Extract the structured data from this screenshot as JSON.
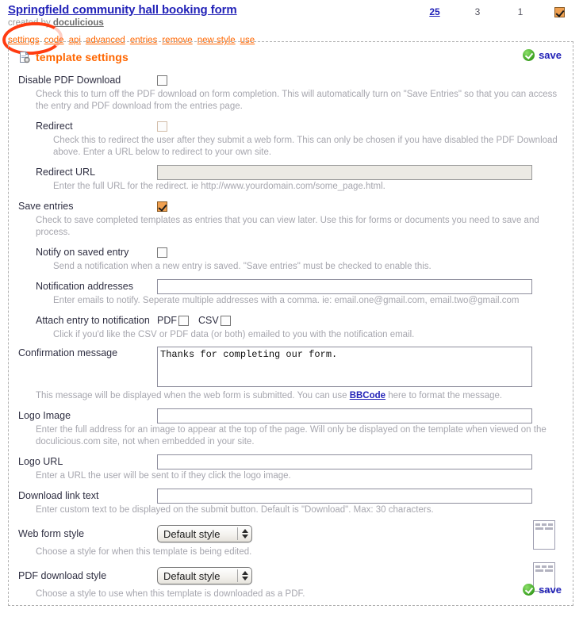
{
  "header": {
    "title": "Springfield community hall booking form",
    "created_prefix": "created by",
    "author": "doculicious",
    "nav": [
      {
        "label": "settings"
      },
      {
        "label": "code"
      },
      {
        "label": "api"
      },
      {
        "label": "advanced"
      },
      {
        "label": "entries"
      },
      {
        "label": "remove"
      },
      {
        "label": "new style"
      },
      {
        "label": "use"
      }
    ],
    "stats": {
      "entries_count": "25",
      "second_count": "3",
      "third_count": "1",
      "active_icon": "checkbox-checked-icon"
    },
    "annotation": "settings-highlight-circle"
  },
  "panel": {
    "icon": "document-gear-icon",
    "title": "template settings",
    "save_top": {
      "label": "save",
      "icon": "green-check-icon"
    },
    "save_bottom": {
      "label": "save",
      "icon": "green-check-icon"
    },
    "fields": {
      "disable_pdf": {
        "label": "Disable PDF Download",
        "checked": false,
        "help": "Check this to turn off the PDF download on form completion. This will automatically turn on \"Save Entries\" so that you can access the entry and PDF download from the entries page."
      },
      "redirect": {
        "label": "Redirect",
        "checked": false,
        "disabled": true,
        "help": "Check this to redirect the user after they submit a web form. This can only be chosen if you have disabled the PDF Download above. Enter a URL below to redirect to your own site."
      },
      "redirect_url": {
        "label": "Redirect URL",
        "value": "",
        "placeholder": "",
        "disabled": true,
        "help": "Enter the full URL for the redirect. ie http://www.yourdomain.com/some_page.html."
      },
      "save_entries": {
        "label": "Save entries",
        "checked": true,
        "help": "Check to save completed templates as entries that you can view later. Use this for forms or documents you need to save and process."
      },
      "notify_on_saved_entry": {
        "label": "Notify on saved entry",
        "checked": false,
        "help": "Send a notification when a new entry is saved. \"Save entries\" must be checked to enable this."
      },
      "notification_addresses": {
        "label": "Notification addresses",
        "value": "",
        "placeholder": "",
        "help": "Enter emails to notify. Seperate multiple addresses with a comma. ie: email.one@gmail.com, email.two@gmail.com"
      },
      "attach_entry": {
        "label": "Attach entry to notification",
        "pdf_label": "PDF",
        "pdf_checked": false,
        "csv_label": "CSV",
        "csv_checked": false,
        "help": "Click if you'd like the CSV or PDF data (or both) emailed to you with the notification email."
      },
      "confirmation_message": {
        "label": "Confirmation message",
        "value": "Thanks for completing our form.",
        "placeholder": "",
        "help_before": "This message will be displayed when the web form is submitted. You can use ",
        "help_link": "BBCode",
        "help_after": " here to format the message."
      },
      "logo_image": {
        "label": "Logo Image",
        "value": "",
        "placeholder": "",
        "help": "Enter the full address for an image to appear at the top of the page. Will only be displayed on the template when viewed on the doculicious.com site, not when embedded in your site."
      },
      "logo_url": {
        "label": "Logo URL",
        "value": "",
        "placeholder": "",
        "help": "Enter a URL the user will be sent to if they click the logo image."
      },
      "download_link_text": {
        "label": "Download link text",
        "value": "",
        "placeholder": "",
        "help": "Enter custom text to be displayed on the submit button. Default is \"Download\". Max: 30 characters."
      },
      "web_form_style": {
        "label": "Web form style",
        "value": "Default style",
        "options": [
          "Default style"
        ],
        "help": "Choose a style for when this template is being edited.",
        "preview": "style-thumbnail"
      },
      "pdf_download_style": {
        "label": "PDF download style",
        "value": "Default style",
        "options": [
          "Default style"
        ],
        "help": "Choose a style to use when this template is downloaded as a PDF.",
        "preview": "style-thumbnail"
      }
    }
  }
}
